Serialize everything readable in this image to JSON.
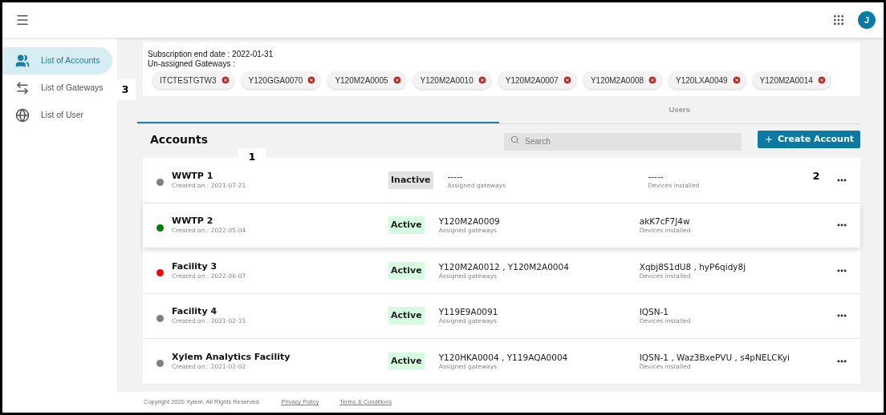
{
  "header": {
    "avatar": "J"
  },
  "sidebar": {
    "items": [
      {
        "label": "List of Accounts",
        "kind": "people",
        "selected": true
      },
      {
        "label": "List of Gateways",
        "kind": "swap",
        "selected": false
      },
      {
        "label": "List of User",
        "kind": "globe",
        "selected": false
      }
    ]
  },
  "info": {
    "subscription": "Subscription end date : 2022-01-31",
    "unassigned_label": "Un-assigned Gateways :",
    "gateways": [
      "ITCTESTGTW3",
      "Y120GGA0070",
      "Y120M2A0005",
      "Y120M2A0010",
      "Y120M2A0007",
      "Y120M2A0008",
      "Y120LXA0049",
      "Y120M2A0014"
    ]
  },
  "tabs": [
    {
      "selected": true
    },
    {
      "label": "Users",
      "selected": false
    }
  ],
  "accounts": {
    "title": "Accounts",
    "search": {
      "placeholder": "Search"
    },
    "create_button": "Create Account",
    "rows": [
      {
        "name": "WWTP 1",
        "created": "Created on : 2021-07-21",
        "color": "#808080",
        "status": "Inactive",
        "active": false,
        "gateways": "-----",
        "gateways_label": "Assigned gateways",
        "devices": "-----",
        "devices_label": "Devices installed",
        "highlighted": false
      },
      {
        "name": "WWTP 2",
        "created": "Created on : 2022-05-04",
        "color": "#008000",
        "status": "Active",
        "active": true,
        "gateways": "Y120M2A0009",
        "gateways_label": "Assigned gateways",
        "devices": "akK7cF7J4w",
        "devices_label": "Devices installed",
        "highlighted": true
      },
      {
        "name": "Facility 3",
        "created": "Created on : 2022-06-07",
        "color": "#ff0000",
        "status": "Active",
        "active": true,
        "gateways": "Y120M2A0012 , Y120M2A0004",
        "gateways_label": "Assigned gateways",
        "devices": "Xqbj8S1dU8 , hyP6qidy8j",
        "devices_label": "Devices installed",
        "highlighted": false
      },
      {
        "name": "Facility 4",
        "created": "Created on : 2021-02-15",
        "color": "#808080",
        "status": "Active",
        "active": true,
        "gateways": "Y119E9A0091",
        "gateways_label": "Assigned gateways",
        "devices": "IQSN-1",
        "devices_label": "Devices installed",
        "highlighted": false
      },
      {
        "name": "Xylem Analytics Facility",
        "created": "Created on : 2021-02-02",
        "color": "#808080",
        "status": "Active",
        "active": true,
        "gateways": "Y120HKA0004 , Y119AQA0004",
        "gateways_label": "Assigned gateways",
        "devices": "IQSN-1 , Waz3BxePVU , s4pNELCKyi",
        "devices_label": "Devices installed",
        "highlighted": false
      }
    ]
  },
  "footer": {
    "copyright": "Copyright 2020 Xylem. All Rights Reserved.",
    "links": [
      "Privacy Policy",
      "Terms & Conditions"
    ]
  },
  "callouts": [
    "1",
    "2",
    "3"
  ]
}
